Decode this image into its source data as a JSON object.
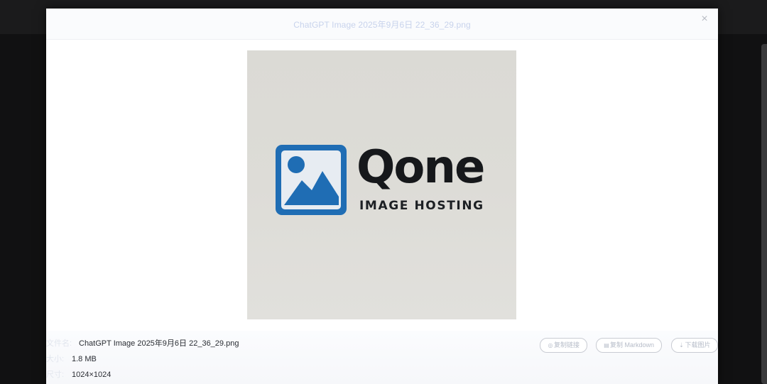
{
  "modal": {
    "title": "ChatGPT Image 2025年9月6日 22_36_29.png",
    "close_icon": "close-icon"
  },
  "preview": {
    "logo_word": "Qone",
    "logo_subtitle": "IMAGE HOSTING",
    "logo_tile_color": "#1f6db4"
  },
  "info": {
    "filename_label": "文件名:",
    "filename_value": "ChatGPT Image 2025年9月6日 22_36_29.png",
    "size_label": "大小:",
    "size_value": "1.8 MB",
    "dimensions_label": "尺寸:",
    "dimensions_value": "1024×1024"
  },
  "actions": {
    "copy_link": "复制链接",
    "copy_markdown": "复制 Markdown",
    "download": "下载图片"
  }
}
